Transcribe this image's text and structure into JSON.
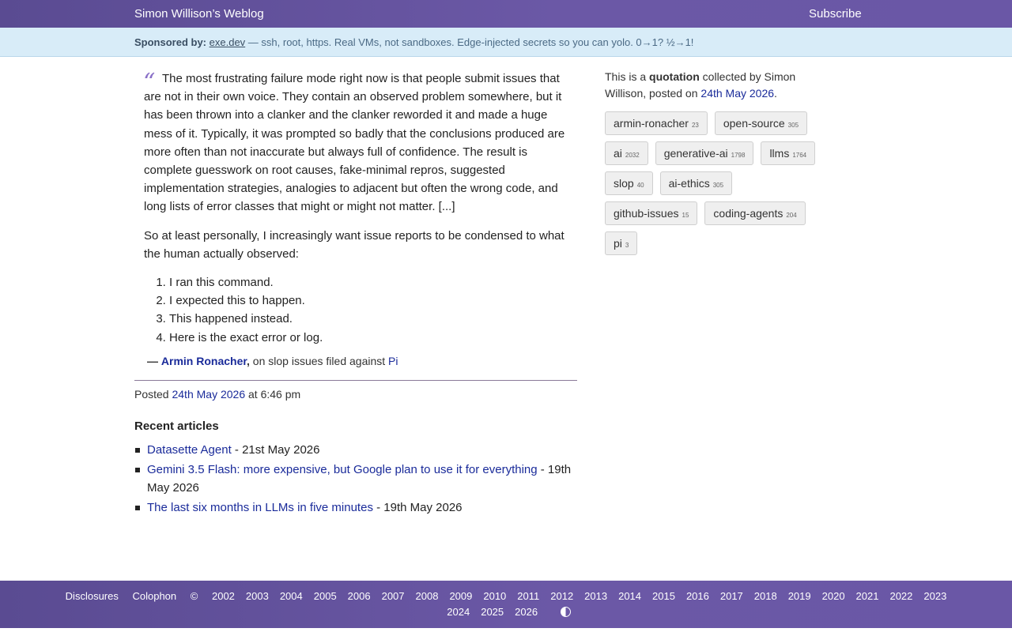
{
  "header": {
    "site_title": "Simon Willison’s Weblog",
    "subscribe": "Subscribe"
  },
  "sponsor": {
    "label": "Sponsored by:",
    "link": "exe.dev",
    "text": " — ssh, root, https. Real VMs, not sandboxes. Edge-injected secrets so you can yolo. 0→1? ½→1!"
  },
  "quote": {
    "para1": "The most frustrating failure mode right now is that people submit issues that are not in their own voice. They contain an observed problem somewhere, but it has been thrown into a clanker and the clanker reworded it and made a huge mess of it. Typically, it was prompted so badly that the conclusions produced are more often than not inaccurate but always full of confidence. The result is complete guesswork on root causes, fake-minimal repros, suggested implementation strategies, analogies to adjacent but often the wrong code, and long lists of error classes that might or might not matter. [...]",
    "para2": "So at least personally, I increasingly want issue reports to be condensed to what the human actually observed:",
    "list": [
      "I ran this command.",
      "I expected this to happen.",
      "This happened instead.",
      "Here is the exact error or log."
    ],
    "cite_dash": "—",
    "cite_author": "Armin Ronacher",
    "cite_comma": ",",
    "cite_text": " on slop issues filed against ",
    "cite_link": "Pi"
  },
  "posted": {
    "prefix": "Posted ",
    "date": "24th May 2026",
    "suffix": " at 6:46 pm"
  },
  "recent": {
    "heading": "Recent articles",
    "items": [
      {
        "title": "Datasette Agent",
        "date": " - 21st May 2026"
      },
      {
        "title": "Gemini 3.5 Flash: more expensive, but Google plan to use it for everything",
        "date": " - 19th May 2026"
      },
      {
        "title": "The last six months in LLMs in five minutes",
        "date": " - 19th May 2026"
      }
    ]
  },
  "sidebar": {
    "pre": "This is a ",
    "kind": "quotation",
    "mid": " collected by Simon Willison, posted on ",
    "date": "24th May 2026",
    "end": ".",
    "tags": [
      {
        "name": "armin-ronacher",
        "count": "23"
      },
      {
        "name": "open-source",
        "count": "305"
      },
      {
        "name": "ai",
        "count": "2032"
      },
      {
        "name": "generative-ai",
        "count": "1798"
      },
      {
        "name": "llms",
        "count": "1764"
      },
      {
        "name": "slop",
        "count": "40"
      },
      {
        "name": "ai-ethics",
        "count": "305"
      },
      {
        "name": "github-issues",
        "count": "15"
      },
      {
        "name": "coding-agents",
        "count": "204"
      },
      {
        "name": "pi",
        "count": "3"
      }
    ]
  },
  "footer": {
    "disclosures": "Disclosures",
    "colophon": "Colophon",
    "copyright": "©",
    "years_row1": [
      "2002",
      "2003",
      "2004",
      "2005",
      "2006",
      "2007",
      "2008",
      "2009",
      "2010",
      "2011",
      "2012",
      "2013",
      "2014",
      "2015",
      "2016",
      "2017",
      "2018",
      "2019",
      "2020",
      "2021",
      "2022",
      "2023"
    ],
    "years_row2": [
      "2024",
      "2025",
      "2026"
    ],
    "contrast_icon": "contrast-icon"
  }
}
